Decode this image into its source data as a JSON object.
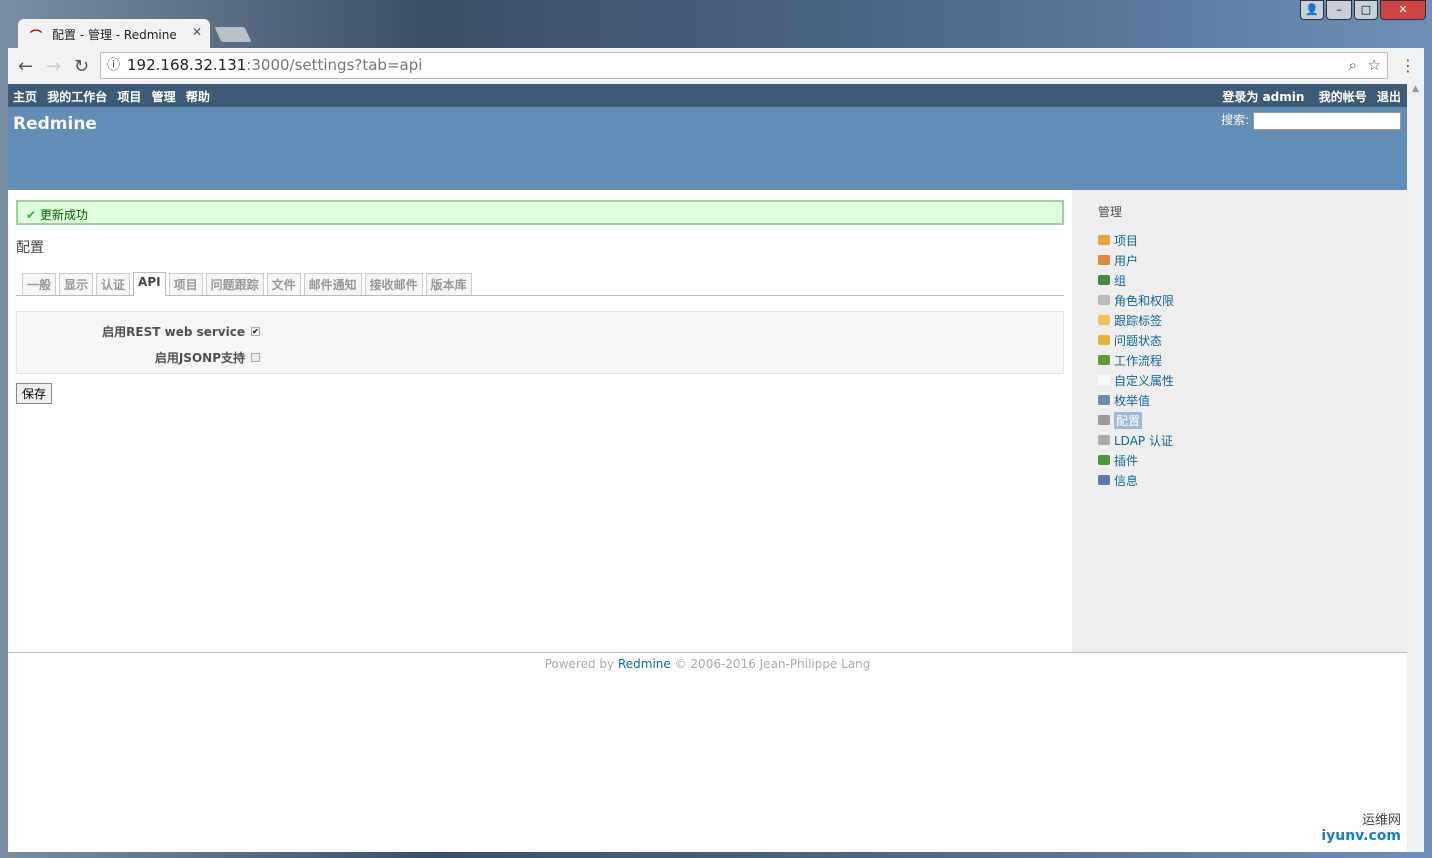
{
  "browser": {
    "tab_title": "配置 - 管理 - Redmine",
    "url_host": "192.168.32.131",
    "url_rest": ":3000/settings?tab=api"
  },
  "top_menu": {
    "left": [
      "主页",
      "我的工作台",
      "项目",
      "管理",
      "帮助"
    ],
    "logged_as": "登录为",
    "user": "admin",
    "my_account": "我的帐号",
    "logout": "退出"
  },
  "header": {
    "title": "Redmine",
    "search_label": "搜索:",
    "search_value": ""
  },
  "flash": "更新成功",
  "page_title": "配置",
  "tabs": [
    "一般",
    "显示",
    "认证",
    "API",
    "项目",
    "问题跟踪",
    "文件",
    "邮件通知",
    "接收邮件",
    "版本库"
  ],
  "selected_tab": "API",
  "settings": [
    {
      "label": "启用REST web service",
      "checked": true
    },
    {
      "label": "启用JSONP支持",
      "checked": false
    }
  ],
  "save_label": "保存",
  "sidebar": {
    "title": "管理",
    "items": [
      {
        "label": "项目",
        "color": "#e8a040"
      },
      {
        "label": "用户",
        "color": "#d98a3a"
      },
      {
        "label": "组",
        "color": "#4a8a4a"
      },
      {
        "label": "角色和权限",
        "color": "#bbb"
      },
      {
        "label": "跟踪标签",
        "color": "#f0c060"
      },
      {
        "label": "问题状态",
        "color": "#e0b040"
      },
      {
        "label": "工作流程",
        "color": "#5a9a3a"
      },
      {
        "label": "自定义属性",
        "color": "#fafafa"
      },
      {
        "label": "枚举值",
        "color": "#6a8ab0"
      },
      {
        "label": "配置",
        "color": "#999"
      },
      {
        "label": "LDAP 认证",
        "color": "#aaa"
      },
      {
        "label": "插件",
        "color": "#4a9a3a"
      },
      {
        "label": "信息",
        "color": "#5a7ab0"
      }
    ],
    "selected": "配置"
  },
  "footer": {
    "prefix": "Powered by",
    "link": "Redmine",
    "suffix": "© 2006-2016 Jean-Philippe Lang"
  },
  "watermark": {
    "cn": "运维网",
    "en": "iyunv.com"
  }
}
